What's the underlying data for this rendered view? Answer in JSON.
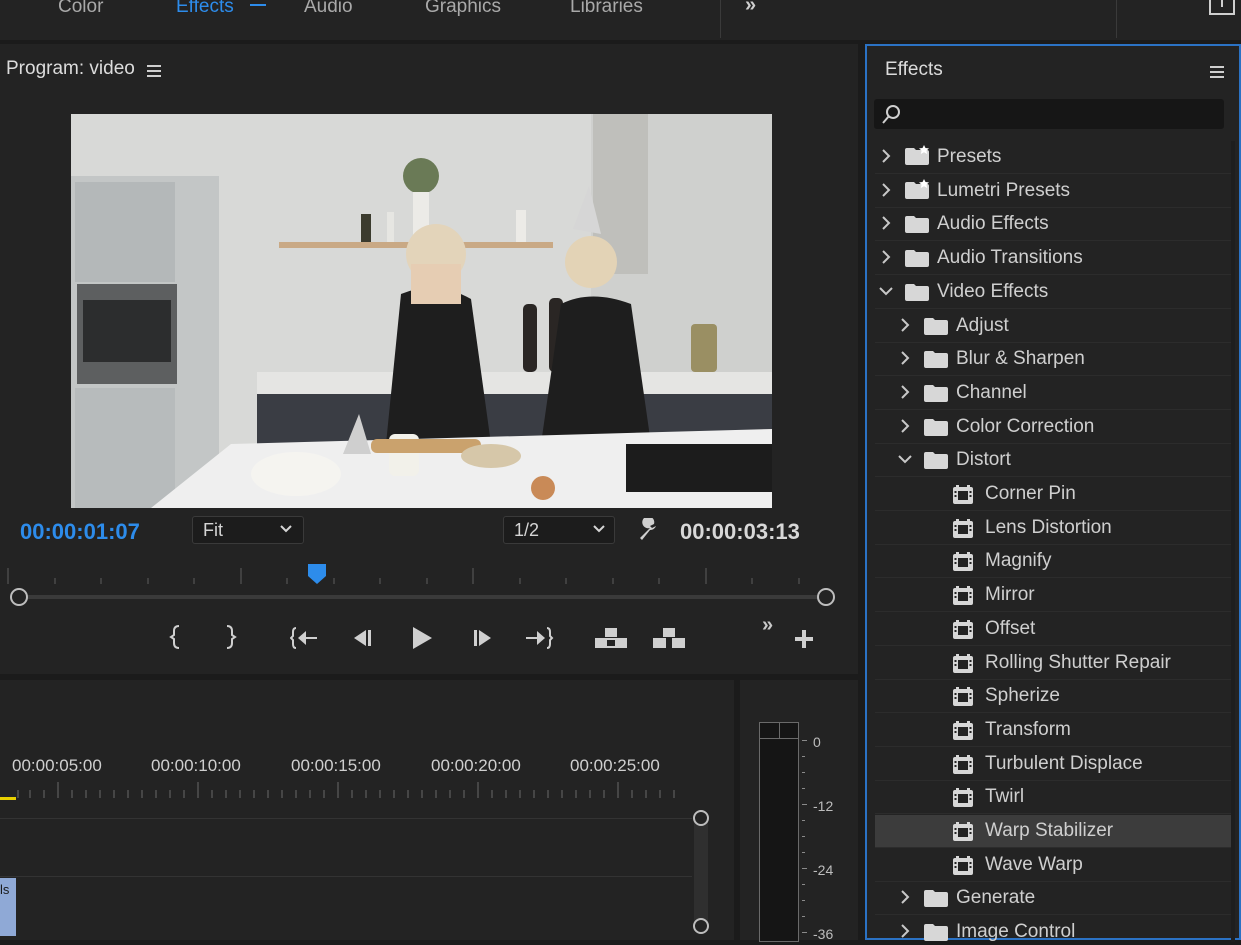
{
  "workspace_tabs": [
    {
      "label": "Color",
      "active": false
    },
    {
      "label": "Effects",
      "active": true
    },
    {
      "label": "Audio",
      "active": false
    },
    {
      "label": "Graphics",
      "active": false
    },
    {
      "label": "Libraries",
      "active": false
    }
  ],
  "program": {
    "title": "Program: video",
    "current_time": "00:00:01:07",
    "duration": "00:00:03:13",
    "zoom_value": "Fit",
    "resolution_value": "1/2",
    "playhead_fraction": 0.37
  },
  "timeline": {
    "ruler_labels": [
      "00:00:05:00",
      "00:00:10:00",
      "00:00:15:00",
      "00:00:20:00",
      "00:00:25:00"
    ],
    "clip_label": "ls"
  },
  "meter": {
    "scale_labels": [
      "0",
      "-12",
      "-24",
      "-36"
    ]
  },
  "effects": {
    "title": "Effects",
    "search_placeholder": "",
    "tree": [
      {
        "label": "Presets",
        "type": "preset-folder",
        "depth": 0,
        "expanded": false
      },
      {
        "label": "Lumetri Presets",
        "type": "preset-folder",
        "depth": 0,
        "expanded": false
      },
      {
        "label": "Audio Effects",
        "type": "folder",
        "depth": 0,
        "expanded": false
      },
      {
        "label": "Audio Transitions",
        "type": "folder",
        "depth": 0,
        "expanded": false
      },
      {
        "label": "Video Effects",
        "type": "folder",
        "depth": 0,
        "expanded": true
      },
      {
        "label": "Adjust",
        "type": "folder",
        "depth": 1,
        "expanded": false
      },
      {
        "label": "Blur & Sharpen",
        "type": "folder",
        "depth": 1,
        "expanded": false
      },
      {
        "label": "Channel",
        "type": "folder",
        "depth": 1,
        "expanded": false
      },
      {
        "label": "Color Correction",
        "type": "folder",
        "depth": 1,
        "expanded": false
      },
      {
        "label": "Distort",
        "type": "folder",
        "depth": 1,
        "expanded": true
      },
      {
        "label": "Corner Pin",
        "type": "effect",
        "depth": 2
      },
      {
        "label": "Lens Distortion",
        "type": "effect",
        "depth": 2
      },
      {
        "label": "Magnify",
        "type": "effect",
        "depth": 2
      },
      {
        "label": "Mirror",
        "type": "effect",
        "depth": 2
      },
      {
        "label": "Offset",
        "type": "effect",
        "depth": 2
      },
      {
        "label": "Rolling Shutter Repair",
        "type": "effect",
        "depth": 2
      },
      {
        "label": "Spherize",
        "type": "effect",
        "depth": 2
      },
      {
        "label": "Transform",
        "type": "effect",
        "depth": 2
      },
      {
        "label": "Turbulent Displace",
        "type": "effect",
        "depth": 2
      },
      {
        "label": "Twirl",
        "type": "effect",
        "depth": 2
      },
      {
        "label": "Warp Stabilizer",
        "type": "effect",
        "depth": 2,
        "selected": true
      },
      {
        "label": "Wave Warp",
        "type": "effect",
        "depth": 2
      },
      {
        "label": "Generate",
        "type": "folder",
        "depth": 1,
        "expanded": false
      },
      {
        "label": "Image Control",
        "type": "folder",
        "depth": 1,
        "expanded": false
      }
    ]
  },
  "colors": {
    "accent": "#2d8ceb",
    "panel": "#232323",
    "selection": "#3c3c3c",
    "panel_focus_border": "#2b72c4"
  }
}
